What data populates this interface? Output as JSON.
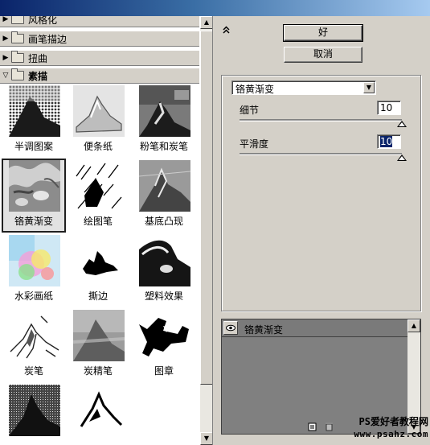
{
  "categories": [
    {
      "label": "风格化",
      "expanded": false
    },
    {
      "label": "画笔描边",
      "expanded": false
    },
    {
      "label": "扭曲",
      "expanded": false
    },
    {
      "label": "素描",
      "expanded": true
    }
  ],
  "filters": [
    {
      "label": "半调图案",
      "selected": false
    },
    {
      "label": "便条纸",
      "selected": false
    },
    {
      "label": "粉笔和炭笔",
      "selected": false
    },
    {
      "label": "铬黄渐变",
      "selected": true
    },
    {
      "label": "绘图笔",
      "selected": false
    },
    {
      "label": "基底凸现",
      "selected": false
    },
    {
      "label": "水彩画纸",
      "selected": false
    },
    {
      "label": "撕边",
      "selected": false
    },
    {
      "label": "塑料效果",
      "selected": false
    },
    {
      "label": "炭笔",
      "selected": false
    },
    {
      "label": "炭精笔",
      "selected": false
    },
    {
      "label": "图章",
      "selected": false
    },
    {
      "label": "",
      "selected": false
    },
    {
      "label": "",
      "selected": false
    }
  ],
  "buttons": {
    "ok": "好",
    "cancel": "取消"
  },
  "collapse_icon": "double-chevron-up-icon",
  "filter_select": {
    "value": "铬黄渐变"
  },
  "params": [
    {
      "label": "细节",
      "value": "10",
      "slider_fraction": 1.0
    },
    {
      "label": "平滑度",
      "value": "10",
      "slider_fraction": 1.0
    }
  ],
  "layers": [
    {
      "name": "铬黄渐变",
      "visible": true
    }
  ],
  "watermark": {
    "line1": "PS爱好者教程网",
    "line2": "www.psahz.com"
  }
}
